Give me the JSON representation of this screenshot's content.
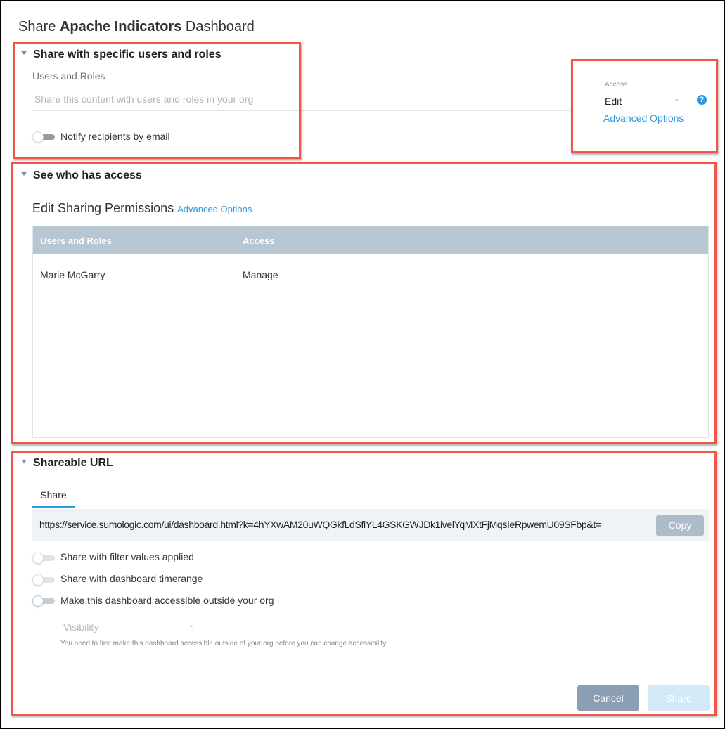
{
  "dialog": {
    "title_prefix": "Share ",
    "title_name": "Apache Indicators",
    "title_suffix": " Dashboard"
  },
  "share_users": {
    "heading": "Share with specific users and roles",
    "field_label": "Users and Roles",
    "placeholder": "Share this content with users and roles in your org",
    "notify_label": "Notify recipients by email",
    "notify_on": false
  },
  "access": {
    "label": "Access",
    "value": "Edit",
    "advanced_options": "Advanced Options",
    "help_icon": "question-circle-icon"
  },
  "who_has_access": {
    "heading": "See who has access",
    "subheading": "Edit Sharing Permissions",
    "advanced_options": "Advanced Options",
    "columns": [
      "Users and Roles",
      "Access"
    ],
    "rows": [
      {
        "user": "Marie McGarry",
        "access": "Manage"
      }
    ]
  },
  "shareable_url": {
    "heading": "Shareable URL",
    "tab": "Share",
    "url": "https://service.sumologic.com/ui/dashboard.html?k=4hYXwAM20uWQGkfLdSfiYL4GSKGWJDk1ivelYqMXtFjMqsIeRpwemU09SFbp&t=",
    "copy": "Copy",
    "options": [
      {
        "label": "Share with filter values applied",
        "on": false
      },
      {
        "label": "Share with dashboard timerange",
        "on": false
      },
      {
        "label": "Make this dashboard accessible outside your org",
        "on": false
      }
    ],
    "visibility_placeholder": "Visibility",
    "visibility_hint": "You need to first make this dashboard accessible outside of your org before you can change accessibility"
  },
  "footer": {
    "cancel": "Cancel",
    "share": "Share"
  },
  "colors": {
    "accent": "#2d9be0",
    "highlight": "#f0574a",
    "table_header": "#b8c5d2",
    "cancel": "#8a9fb4",
    "share_disabled": "#d4e9f8"
  }
}
